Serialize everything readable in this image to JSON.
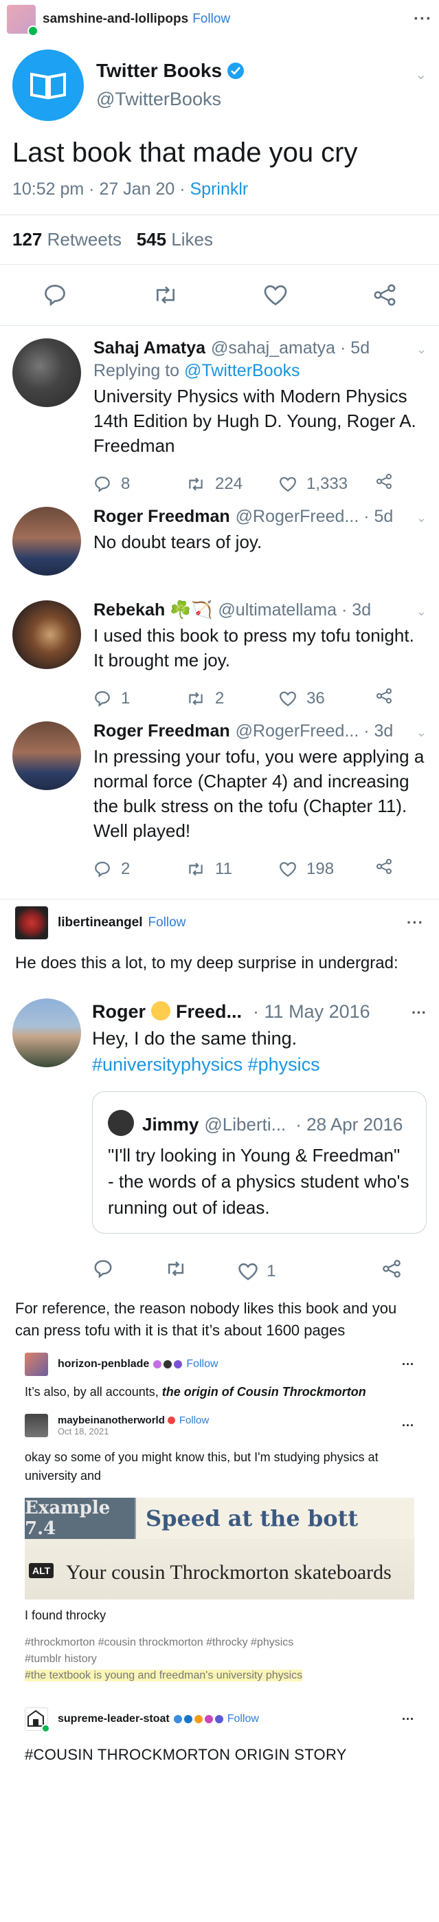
{
  "post_header": {
    "username": "samshine-and-lollipops",
    "follow_label": "Follow"
  },
  "main_tweet": {
    "display_name": "Twitter Books",
    "handle": "@TwitterBooks",
    "text": "Last book that made you cry",
    "time": "10:52 pm · 27 Jan 20 · ",
    "source": "Sprinklr",
    "retweets_count": "127",
    "retweets_label": "Retweets",
    "likes_count": "545",
    "likes_label": "Likes"
  },
  "replies": [
    {
      "name": "Sahaj Amatya",
      "handle": "@sahaj_amatya · 5d",
      "replying_prefix": "Replying to ",
      "replying_to": "@TwitterBooks",
      "text": "University Physics with Modern Physics 14th Edition by Hugh D. Young, Roger A. Freedman",
      "replies": "8",
      "retweets": "224",
      "likes": "1,333"
    },
    {
      "name": "Roger Freedman",
      "handle": "@RogerFreed... · 5d",
      "text": "No doubt tears of joy."
    },
    {
      "name": "Rebekah ☘️🏹",
      "handle": "@ultimatellama · 3d",
      "text": "I used this book to press my tofu tonight. It brought me joy.",
      "replies": "1",
      "retweets": "2",
      "likes": "36"
    },
    {
      "name": "Roger Freedman",
      "handle": "@RogerFreed... · 3d",
      "text": "In pressing your tofu, you were applying a normal force (Chapter 4) and increasing the bulk stress on the tofu (Chapter 11). Well played!",
      "replies": "2",
      "retweets": "11",
      "likes": "198"
    }
  ],
  "reblog1": {
    "username": "libertineangel",
    "follow_label": "Follow",
    "text": "He does this a lot, to my deep surprise in undergrad:"
  },
  "roger_tweet": {
    "name_a": "Roger",
    "name_b": "Freed...",
    "date": "· 11 May 2016",
    "text_line1": "Hey, I do the same thing.",
    "hashtags": "#universityphysics #physics",
    "quote": {
      "name": "Jimmy",
      "handle": "@Liberti...",
      "date": "· 28 Apr 2016",
      "text": "\"I'll try looking in Young & Freedman\" - the words of a physics student who's running out of ideas."
    },
    "likes": "1"
  },
  "reblog1_followup": "For reference, the reason nobody likes this book and you can press tofu with it is that it’s about 1600 pages",
  "reblog2": {
    "username": "horizon-penblade",
    "follow_label": "Follow",
    "text_plain": "It’s also, by all accounts, ",
    "text_emph": "the origin of Cousin Throckmorton"
  },
  "reblog3": {
    "username": "maybeinanotherworld",
    "follow_label": "Follow",
    "date": "Oct 18, 2021",
    "text": "okay so some of you might know this, but I'm studying physics at university and",
    "photo": {
      "example_label": "Example 7.4",
      "title_label": "Speed at the bott",
      "caption": "Your cousin Throckmorton skateboards",
      "alt_badge": "ALT"
    },
    "after_photo": "I found throcky",
    "tags_line1": "#throckmorton  #cousin throckmorton  #throcky  #physics",
    "tags_line2": "#tumblr history",
    "tags_hl": "#the textbook is young and freedman's university physics"
  },
  "reblog4": {
    "username": "supreme-leader-stoat",
    "follow_label": "Follow",
    "text": "#COUSIN THROCKMORTON ORIGIN STORY"
  },
  "colors": {
    "twitter_blue": "#1da1f2",
    "link_blue": "#1b95e0",
    "tumblr_follow": "#2e7dd7",
    "highlight": "#fbf6b6"
  }
}
